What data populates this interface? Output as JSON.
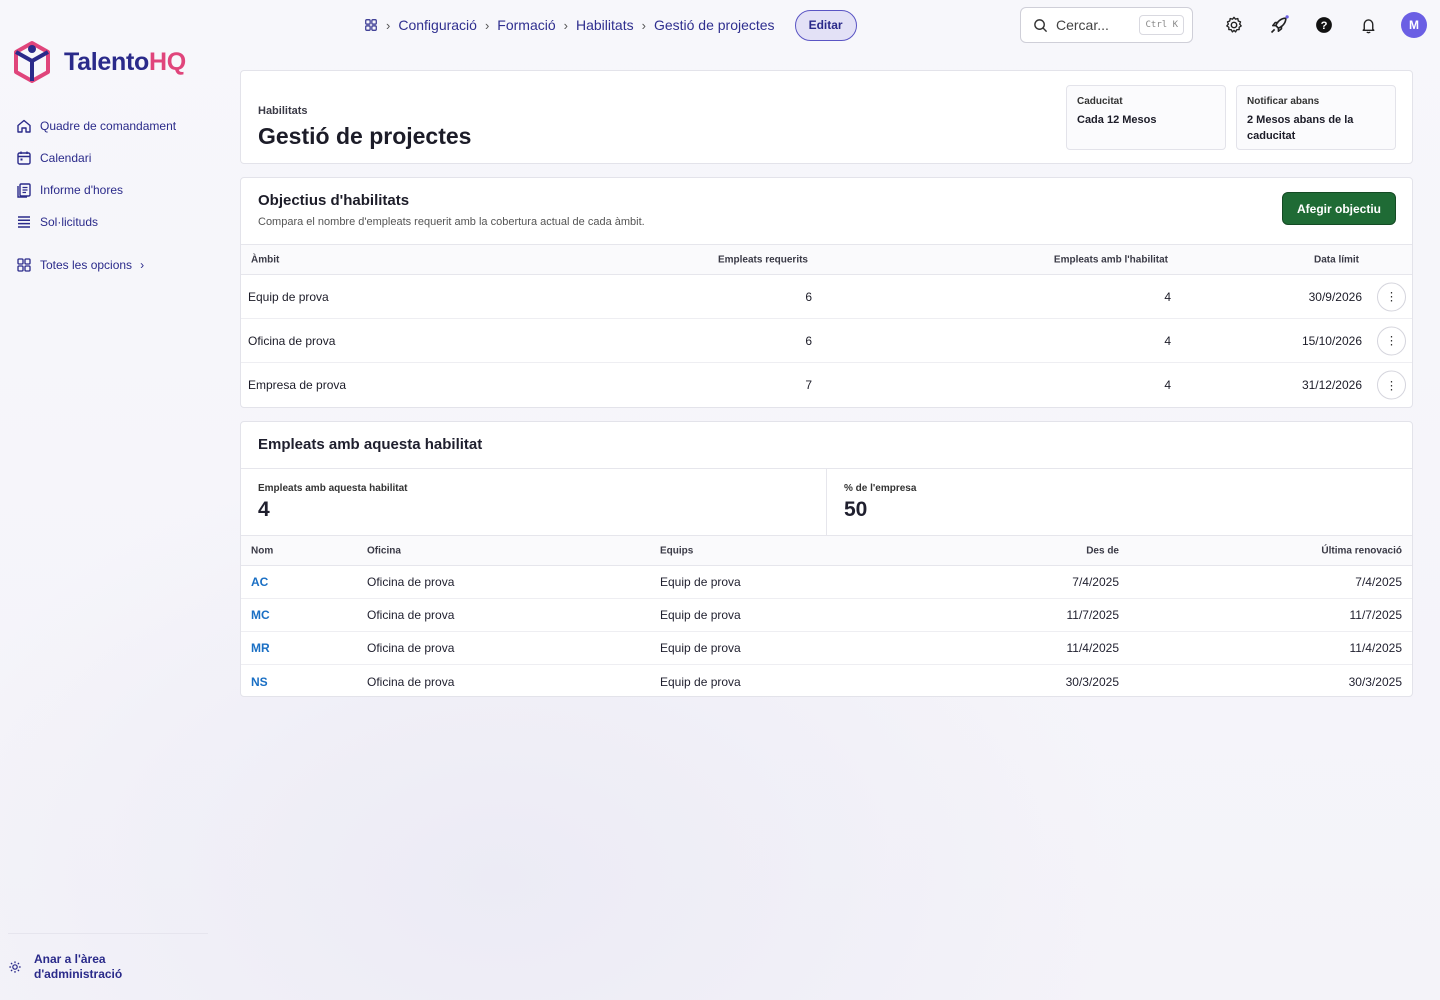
{
  "app": {
    "brand_part1": "Talento",
    "brand_part2": "HQ",
    "accent": "#2a2a8a",
    "brand_pink": "#e0457b",
    "button_green": "#1f6b35",
    "link_blue": "#1a6fc4"
  },
  "sidebar": {
    "items": [
      {
        "label": "Quadre de comandament",
        "icon": "home-icon"
      },
      {
        "label": "Calendari",
        "icon": "calendar-icon"
      },
      {
        "label": "Informe d'hores",
        "icon": "report-icon"
      },
      {
        "label": "Sol·licituds",
        "icon": "list-icon"
      }
    ],
    "all_options": "Totes les opcions",
    "footer_label_line1": "Anar a l'àrea",
    "footer_label_line2": "d'administració"
  },
  "header": {
    "breadcrumbs": [
      "Configuració",
      "Formació",
      "Habilitats",
      "Gestió de projectes"
    ],
    "edit_label": "Editar",
    "search_placeholder": "Cercar...",
    "search_shortcut": "Ctrl K",
    "avatar_initial": "M"
  },
  "skill": {
    "pretitle": "Habilitats",
    "title": "Gestió de projectes",
    "expiry_label": "Caducitat",
    "expiry_value": "Cada 12 Mesos",
    "notify_label": "Notificar abans",
    "notify_value": "2 Mesos abans de la caducitat"
  },
  "goals": {
    "title": "Objectius d'habilitats",
    "subtitle": "Compara el nombre d'empleats requerit amb la cobertura actual de cada àmbit.",
    "add_label": "Afegir objectiu",
    "columns": [
      "Àmbit",
      "Empleats requerits",
      "Empleats amb l'habilitat",
      "Data límit"
    ],
    "rows": [
      {
        "scope": "Equip de prova",
        "required": "6",
        "with_skill": "4",
        "deadline": "30/9/2026"
      },
      {
        "scope": "Oficina de prova",
        "required": "6",
        "with_skill": "4",
        "deadline": "15/10/2026"
      },
      {
        "scope": "Empresa de prova",
        "required": "7",
        "with_skill": "4",
        "deadline": "31/12/2026"
      }
    ]
  },
  "employees": {
    "title": "Empleats amb aquesta habilitat",
    "stat1_label": "Empleats amb aquesta habilitat",
    "stat1_value": "4",
    "stat2_label": "% de l'empresa",
    "stat2_value": "50",
    "columns": [
      "Nom",
      "Oficina",
      "Equips",
      "Des de",
      "Última renovació"
    ],
    "rows": [
      {
        "name": "AC",
        "office": "Oficina de prova",
        "teams": "Equip de prova",
        "since": "7/4/2025",
        "renewal": "7/4/2025"
      },
      {
        "name": "MC",
        "office": "Oficina de prova",
        "teams": "Equip de prova",
        "since": "11/7/2025",
        "renewal": "11/7/2025"
      },
      {
        "name": "MR",
        "office": "Oficina de prova",
        "teams": "Equip de prova",
        "since": "11/4/2025",
        "renewal": "11/4/2025"
      },
      {
        "name": "NS",
        "office": "Oficina de prova",
        "teams": "Equip de prova",
        "since": "30/3/2025",
        "renewal": "30/3/2025"
      }
    ]
  }
}
